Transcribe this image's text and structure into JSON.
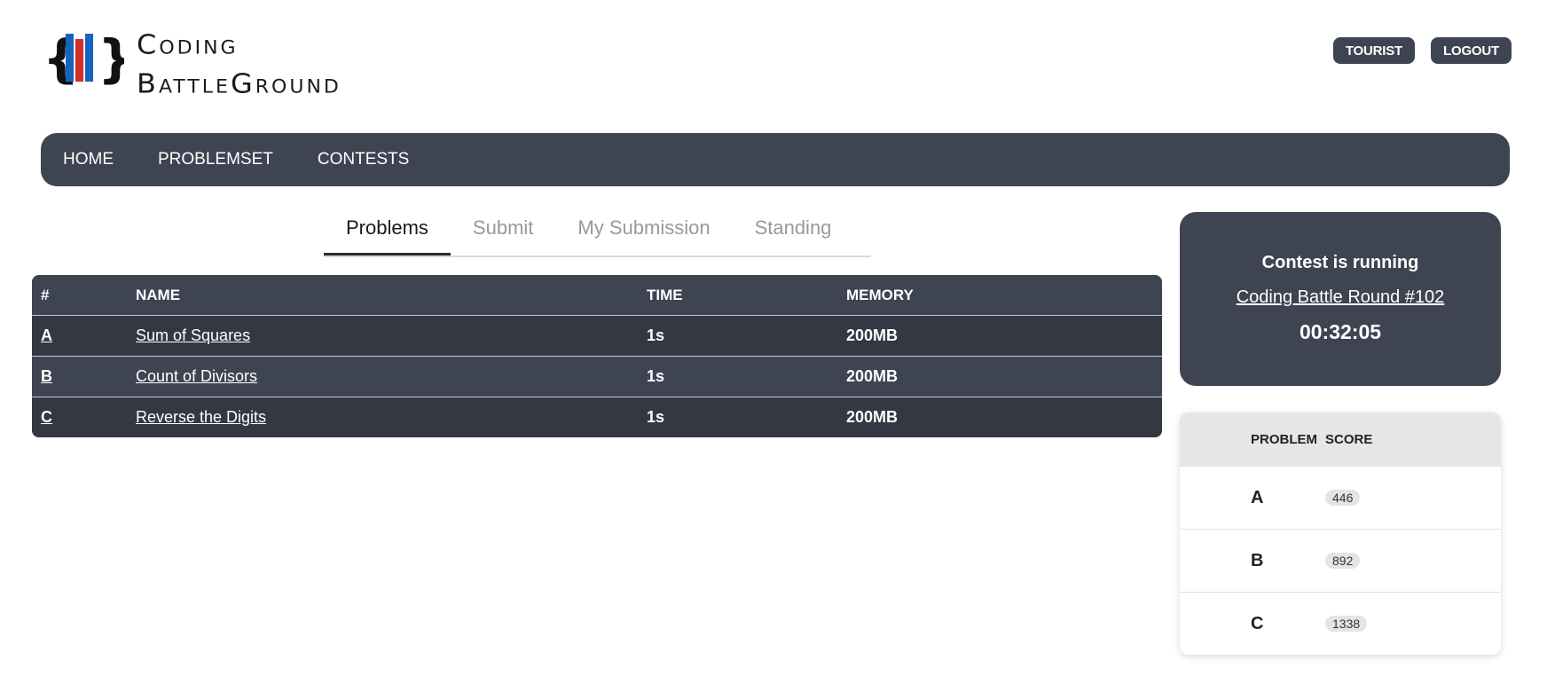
{
  "brand": {
    "line1": "Coding",
    "line2": "BattleGround",
    "colors": {
      "brace": "#111111",
      "blue": "#1565c0",
      "red": "#d32f2f"
    }
  },
  "user_buttons": {
    "user": "TOURIST",
    "logout": "LOGOUT"
  },
  "nav": {
    "items": [
      "HOME",
      "PROBLEMSET",
      "CONTESTS"
    ]
  },
  "tabs": [
    {
      "label": "Problems",
      "active": true
    },
    {
      "label": "Submit",
      "active": false
    },
    {
      "label": "My Submission",
      "active": false
    },
    {
      "label": "Standing",
      "active": false
    }
  ],
  "problems": {
    "headers": {
      "id": "#",
      "name": "NAME",
      "time": "TIME",
      "memory": "MEMORY"
    },
    "rows": [
      {
        "id": "A",
        "name": "Sum of Squares",
        "time": "1s",
        "memory": "200MB"
      },
      {
        "id": "B",
        "name": "Count of Divisors",
        "time": "1s",
        "memory": "200MB"
      },
      {
        "id": "C",
        "name": "Reverse the Digits",
        "time": "1s",
        "memory": "200MB"
      }
    ]
  },
  "contest": {
    "status": "Contest is running",
    "name": "Coding Battle Round #102",
    "timer": "00:32:05"
  },
  "scores": {
    "headers": {
      "problem": "PROBLEM",
      "score": "SCORE"
    },
    "rows": [
      {
        "problem": "A",
        "score": "446"
      },
      {
        "problem": "B",
        "score": "892"
      },
      {
        "problem": "C",
        "score": "1338"
      }
    ]
  },
  "theme": {
    "dark": "#3e4451",
    "darker": "#333842"
  }
}
